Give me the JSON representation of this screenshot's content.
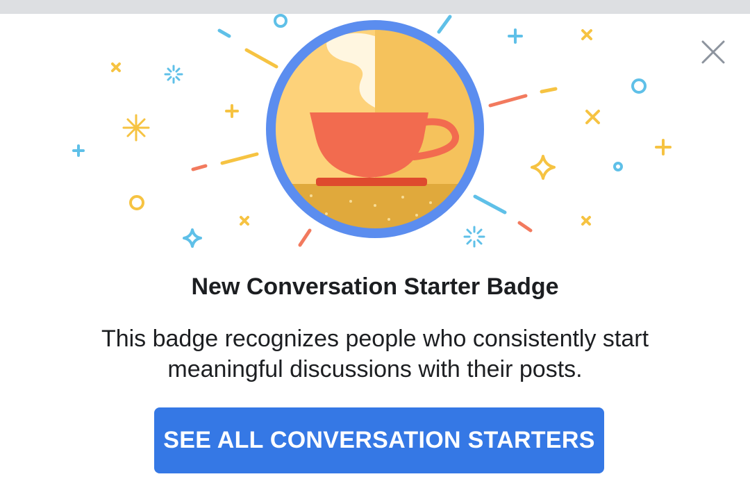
{
  "dialog": {
    "close_icon": "close-icon",
    "title": "New Conversation Starter Badge",
    "description": "This badge recognizes people who consistently start meaningful discussions with their posts.",
    "cta_label": "SEE ALL CONVERSATION STARTERS"
  },
  "colors": {
    "accent": "#3578e5",
    "badge_ring": "#5b8def",
    "cup": "#f26b4f",
    "saucer": "#de4a2e",
    "background_top": "#fdd27a",
    "table": "#e8b04a",
    "confetti_blue": "#5fc0e8",
    "confetti_yellow": "#f6c342",
    "confetti_red": "#f27a5e"
  },
  "illustration": {
    "name": "coffee-cup-badge",
    "decorations": [
      "confetti",
      "sparkles",
      "circles",
      "plus-signs",
      "x-marks"
    ]
  }
}
